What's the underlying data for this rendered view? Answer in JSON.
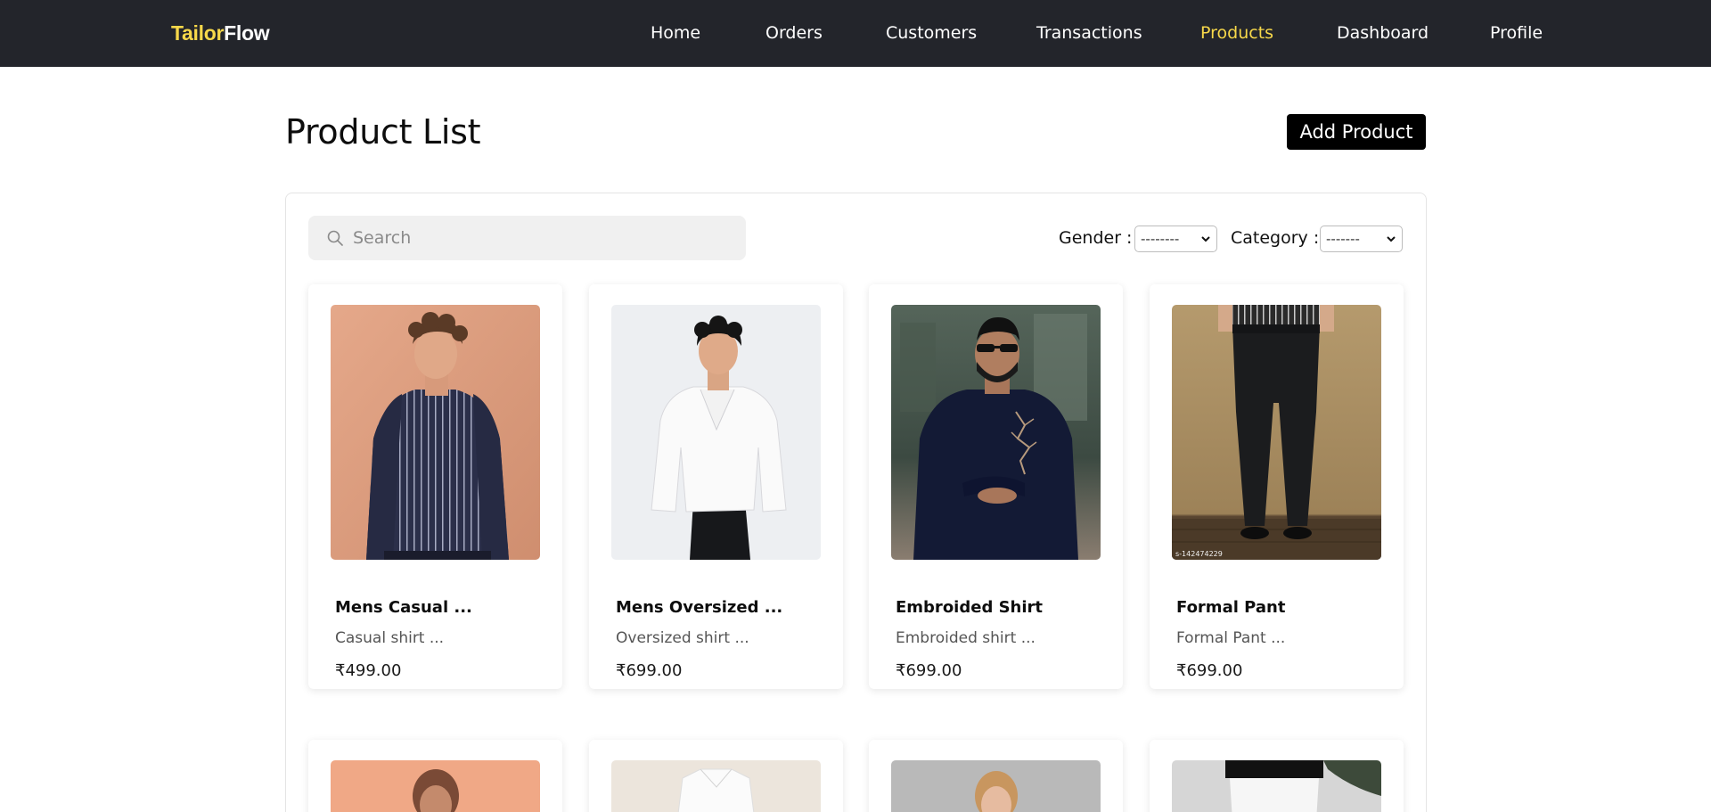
{
  "brand": {
    "part1": "Tailor",
    "part2": "Flow"
  },
  "nav": [
    {
      "label": "Home",
      "active": false
    },
    {
      "label": "Orders",
      "active": false
    },
    {
      "label": "Customers",
      "active": false
    },
    {
      "label": "Transactions",
      "active": false
    },
    {
      "label": "Products",
      "active": true
    },
    {
      "label": "Dashboard",
      "active": false
    },
    {
      "label": "Profile",
      "active": false
    }
  ],
  "page": {
    "title": "Product List",
    "add_button": "Add Product"
  },
  "search": {
    "placeholder": "Search"
  },
  "filters": {
    "gender_label": "Gender :",
    "gender_value": "--------",
    "category_label": "Category :",
    "category_value": "-------"
  },
  "products": [
    {
      "name": "Mens Casual ...",
      "description": "Casual shirt ...",
      "price": "₹499.00",
      "image": "striped-shirt-photo"
    },
    {
      "name": "Mens Oversized ...",
      "description": "Oversized shirt ...",
      "price": "₹699.00",
      "image": "white-oversized-shirt-photo"
    },
    {
      "name": "Embroided Shirt",
      "description": "Embroided shirt ...",
      "price": "₹699.00",
      "image": "embroidered-black-shirt-photo"
    },
    {
      "name": "Formal Pant",
      "description": "Formal Pant ...",
      "price": "₹699.00",
      "image": "formal-pant-photo",
      "image_caption": "s-142474229"
    },
    {
      "image": "womens-top-photo"
    },
    {
      "image": "white-shirt-photo"
    },
    {
      "image": "womens-blouse-photo"
    },
    {
      "image": "white-pant-photo"
    }
  ],
  "colors": {
    "nav_bg": "#23252b",
    "accent": "#f7d84a",
    "button_bg": "#000000"
  }
}
